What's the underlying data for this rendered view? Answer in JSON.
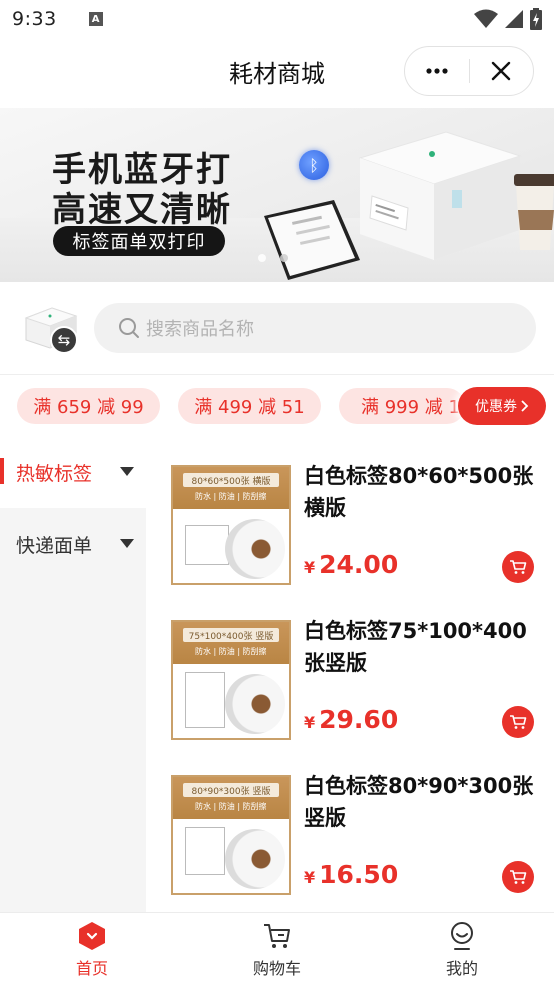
{
  "status_bar": {
    "time": "9:33",
    "notification_icon": "A"
  },
  "header": {
    "title": "耗材商城",
    "more_icon": "more-dots-icon",
    "close_icon": "close-icon"
  },
  "banner": {
    "line1": "手机蓝牙打",
    "line2": "高速又清晰",
    "pill": "标签面单双打印",
    "bluetooth_symbol": "ᛒ"
  },
  "search": {
    "placeholder": "搜索商品名称",
    "swap_symbol": "⇆"
  },
  "coupons": {
    "items": [
      {
        "label": "满 659 减 99"
      },
      {
        "label": "满 499 减 51"
      },
      {
        "label": "满 999 减 1"
      }
    ],
    "more_button": "优惠券"
  },
  "categories": [
    {
      "label": "热敏标签",
      "active": true
    },
    {
      "label": "快递面单",
      "active": false
    }
  ],
  "products": [
    {
      "title": "白色标签80*60*500张横版",
      "currency": "¥",
      "price": "24.00",
      "thumb_tag": "80*60*500张 横版",
      "thumb_sub": "防水 | 防油 | 防刮擦"
    },
    {
      "title": "白色标签75*100*400张竖版",
      "currency": "¥",
      "price": "29.60",
      "thumb_tag": "75*100*400张 竖版",
      "thumb_sub": "防水 | 防油 | 防刮擦"
    },
    {
      "title": "白色标签80*90*300张竖版",
      "currency": "¥",
      "price": "16.50",
      "thumb_tag": "80*90*300张 竖版",
      "thumb_sub": "防水 | 防油 | 防刮擦"
    }
  ],
  "tabbar": [
    {
      "label": "首页",
      "icon": "home-icon",
      "active": true
    },
    {
      "label": "购物车",
      "icon": "cart-icon",
      "active": false
    },
    {
      "label": "我的",
      "icon": "profile-icon",
      "active": false
    }
  ],
  "colors": {
    "accent": "#e8312a",
    "coupon_bg": "#fde4e2",
    "nav_bg": "#f5f5f5"
  }
}
